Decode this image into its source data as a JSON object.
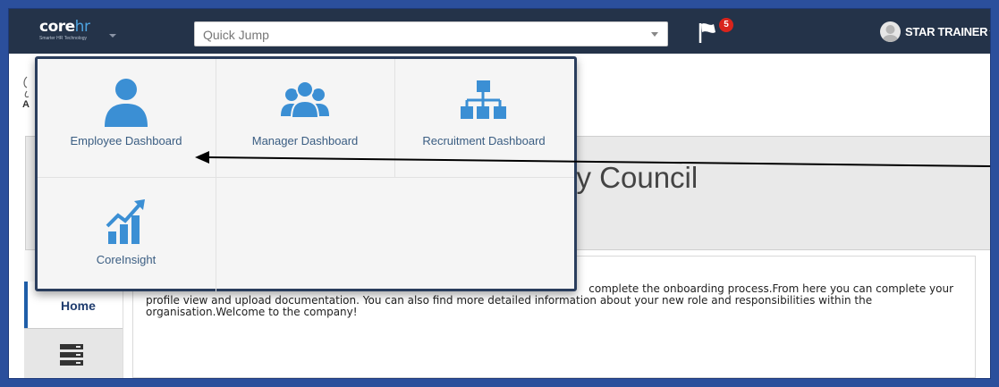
{
  "topbar": {
    "logo_main": "core",
    "logo_accent": "hr",
    "logo_tagline": "Smarter HR Technology",
    "quick_jump_placeholder": "Quick Jump",
    "notification_count": "5",
    "user_name": "STAR TRAINER"
  },
  "page": {
    "org_title_visible": "ity Council",
    "nav_home": "Home",
    "welcome_text": "complete the onboarding process.From here you can complete your profile view and upload documentation. You can also find more detailed information about your new role and responsibilities within the organisation.Welcome to the company!"
  },
  "dropdown": {
    "tiles": [
      {
        "label": "Employee Dashboard",
        "icon": "person-icon"
      },
      {
        "label": "Manager Dashboard",
        "icon": "group-icon"
      },
      {
        "label": "Recruitment Dashboard",
        "icon": "org-chart-icon"
      },
      {
        "label": "CoreInsight",
        "icon": "growth-chart-icon"
      }
    ]
  },
  "colors": {
    "topbar": "#243349",
    "accent": "#4a90d0",
    "badge": "#d9241c",
    "frame": "#2b4f9c"
  }
}
